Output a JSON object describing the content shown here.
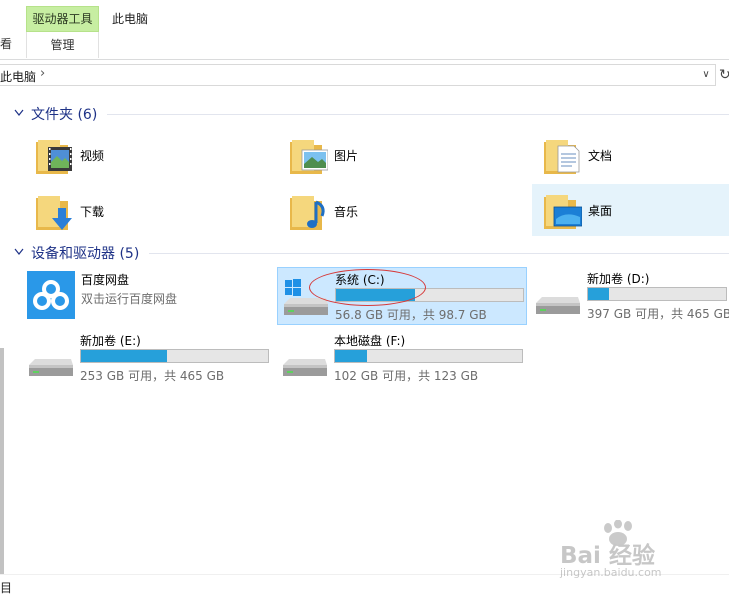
{
  "ribbon": {
    "left_cut_label": "看",
    "context_tab": "驱动器工具",
    "context_sub": "管理",
    "title": "此电脑"
  },
  "address": {
    "path": "此电脑",
    "separator": "›",
    "dropdown": "∨",
    "refresh": "↻"
  },
  "folders_group": {
    "title": "文件夹 (6)",
    "items": [
      {
        "label": "视频",
        "icon": "video-folder-icon"
      },
      {
        "label": "图片",
        "icon": "pictures-folder-icon"
      },
      {
        "label": "文档",
        "icon": "documents-folder-icon"
      },
      {
        "label": "下载",
        "icon": "downloads-folder-icon"
      },
      {
        "label": "音乐",
        "icon": "music-folder-icon"
      },
      {
        "label": "桌面",
        "icon": "desktop-folder-icon",
        "selected": true
      }
    ]
  },
  "devices_group": {
    "title": "设备和驱动器 (5)",
    "baidu": {
      "name": "百度网盘",
      "sub": "双击运行百度网盘"
    },
    "drives": [
      {
        "name": "系统 (C:)",
        "free": "56.8 GB 可用，共 98.7 GB",
        "used_fraction": 0.42,
        "selected": true,
        "windows": true
      },
      {
        "name": "新加卷 (D:)",
        "free": "397 GB 可用，共 465 GB",
        "used_fraction": 0.15
      },
      {
        "name": "新加卷 (E:)",
        "free": "253 GB 可用，共 465 GB",
        "used_fraction": 0.46
      },
      {
        "name": "本地磁盘 (F:)",
        "free": "102 GB 可用，共 123 GB",
        "used_fraction": 0.17
      }
    ]
  },
  "status": {
    "left_cut": "目"
  },
  "watermark": {
    "brand": "Bai  经验",
    "url": "jingyan.baidu.com"
  },
  "colors": {
    "accent": "#26a0da",
    "group_title": "#1e3287",
    "context_tab": "#c7eea2",
    "selection": "#cce8ff",
    "annotation": "#d63a3a"
  }
}
